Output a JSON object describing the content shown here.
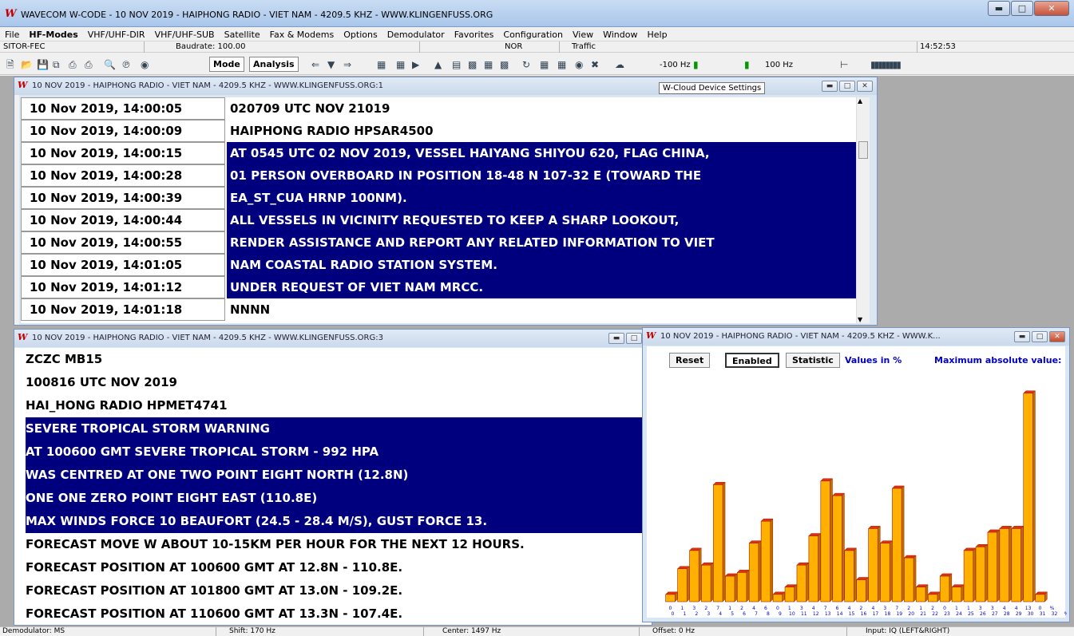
{
  "app": {
    "title": "WAVECOM W-CODE - 10 NOV 2019  -  HAIPHONG RADIO  -  VIET NAM  -  4209.5 KHZ  -  WWW.KLINGENFUSS.ORG",
    "logo": "W"
  },
  "menu": [
    "File",
    "HF-Modes",
    "VHF/UHF-DIR",
    "VHF/UHF-SUB",
    "Satellite",
    "Fax & Modems",
    "Options",
    "Demodulator",
    "Favorites",
    "Configuration",
    "View",
    "Window",
    "Help"
  ],
  "statusrow": {
    "mode": "SITOR-FEC",
    "baudrate": "Baudrate: 100.00",
    "nor": "NOR",
    "traffic": "Traffic",
    "time": "14:52:53"
  },
  "toolbar": {
    "mode_label": "Mode",
    "analysis_label": "Analysis",
    "freq_low": "-100 Hz",
    "freq_high": "100 Hz"
  },
  "tooltip": "W-Cloud Device Settings",
  "window1": {
    "title": "10 NOV 2019  -  HAIPHONG RADIO  -  VIET NAM  -  4209.5 KHZ  -  WWW.KLINGENFUSS.ORG:1",
    "rows": [
      {
        "time": "10 Nov 2019, 14:00:05",
        "text": "020709 UTC NOV 21019"
      },
      {
        "time": "10 Nov 2019, 14:00:09",
        "text": "HAIPHONG RADIO HPSAR4500"
      },
      {
        "time": "10 Nov 2019, 14:00:15",
        "text": "AT 0545 UTC 02 NOV 2019, VESSEL HAIYANG SHIYOU 620, FLAG CHINA,"
      },
      {
        "time": "10 Nov 2019, 14:00:28",
        "text": "01 PERSON OVERBOARD IN POSITION 18-48 N 107-32 E (TOWARD THE"
      },
      {
        "time": "10 Nov 2019, 14:00:39",
        "text": "EA_ST_CUA HRNP 100NM)."
      },
      {
        "time": "10 Nov 2019, 14:00:44",
        "text": "ALL VESSELS IN VICINITY REQUESTED TO KEEP A SHARP LOOKOUT,"
      },
      {
        "time": "10 Nov 2019, 14:00:55",
        "text": "RENDER ASSISTANCE AND REPORT ANY RELATED INFORMATION TO VIET"
      },
      {
        "time": "10 Nov 2019, 14:01:05",
        "text": "NAM COASTAL RADIO STATION SYSTEM."
      },
      {
        "time": "10 Nov 2019, 14:01:12",
        "text": "UNDER REQUEST OF VIET NAM MRCC."
      },
      {
        "time": "10 Nov 2019, 14:01:18",
        "text": "NNNN"
      }
    ]
  },
  "window2": {
    "title": "10 NOV 2019  -  HAIPHONG RADIO  -  VIET NAM  -  4209.5 KHZ  -  WWW.KLINGENFUSS.ORG:3",
    "lines": [
      "ZCZC MB15",
      "100816 UTC NOV 2019",
      "HAI_HONG RADIO HPMET4741",
      "SEVERE TROPICAL STORM WARNING",
      "AT 100600 GMT SEVERE TROPICAL STORM - 992 HPA",
      "WAS CENTRED AT ONE TWO POINT EIGHT NORTH (12.8N)",
      "ONE ONE ZERO POINT EIGHT EAST (110.8E)",
      "MAX WINDS FORCE 10 BEAUFORT (24.5 - 28.4 M/S), GUST FORCE 13.",
      "FORECAST MOVE W ABOUT 10-15KM PER HOUR FOR THE NEXT 12 HOURS.",
      "FORECAST POSITION AT 100600 GMT AT 12.8N - 110.8E.",
      "FORECAST POSITION AT 101800 GMT AT 13.0N - 109.2E.",
      "FORECAST POSITION AT 110600 GMT AT 13.3N - 107.4E."
    ]
  },
  "window3": {
    "title": "10 NOV 2019  -  HAIPHONG RADIO  -  VIET NAM  -  4209.5 KHZ  -  WWW.K...",
    "reset_label": "Reset",
    "enabled_label": "Enabled",
    "statistic_label": "Statistic",
    "values_label": "Values in %",
    "max_label": "Maximum absolute value:"
  },
  "chart_data": {
    "type": "bar",
    "categories": [
      "0",
      "1",
      "2",
      "3",
      "4",
      "5",
      "6",
      "7",
      "8",
      "9",
      "10",
      "11",
      "12",
      "13",
      "14",
      "15",
      "16",
      "17",
      "18",
      "19",
      "20",
      "21",
      "22",
      "23",
      "24",
      "25",
      "26",
      "27",
      "28",
      "29",
      "30",
      "31",
      "32"
    ],
    "values": [
      1,
      4.5,
      7,
      5,
      16,
      3.5,
      4,
      8,
      11,
      1,
      2,
      5,
      9,
      16.5,
      14.5,
      7,
      3,
      10,
      8,
      15.5,
      6,
      2,
      1,
      3.5,
      2,
      7,
      7.5,
      9.5,
      10,
      10,
      28.5,
      1
    ],
    "tick_labels": [
      "0",
      "1",
      "2",
      "3",
      "4",
      "5",
      "6",
      "7",
      "8",
      "9",
      "10",
      "11",
      "12",
      "13",
      "14",
      "15",
      "16",
      "17",
      "18",
      "19",
      "20",
      "21",
      "22",
      "23",
      "24",
      "25",
      "26",
      "27",
      "28",
      "29",
      "30",
      "31",
      "32",
      "%"
    ],
    "top_tick_digits": [
      "0",
      "1",
      "3",
      "2",
      "7",
      "1",
      "2",
      "4",
      "6",
      "0",
      "1",
      "3",
      "4",
      "7",
      "6",
      "4",
      "2",
      "4",
      "3",
      "7",
      "2",
      "1",
      "2",
      "0",
      "1",
      "1",
      "3",
      "3",
      "4",
      "4",
      "13",
      "0",
      "%"
    ],
    "ylim": [
      0,
      30
    ],
    "grid": false,
    "colors": {
      "bar_fill": "#ffb000",
      "bar_top": "#e03010",
      "bar_edge": "#a02000"
    }
  },
  "statusbar": {
    "demodulator": "Demodulator: MS",
    "shift": "Shift: 170 Hz",
    "center": "Center: 1497 Hz",
    "offset": "Offset: 0 Hz",
    "input": "Input: IQ (LEFT&RIGHT)"
  },
  "colors": {
    "highlight": "#00007f",
    "mdi_background": "#ababab"
  }
}
